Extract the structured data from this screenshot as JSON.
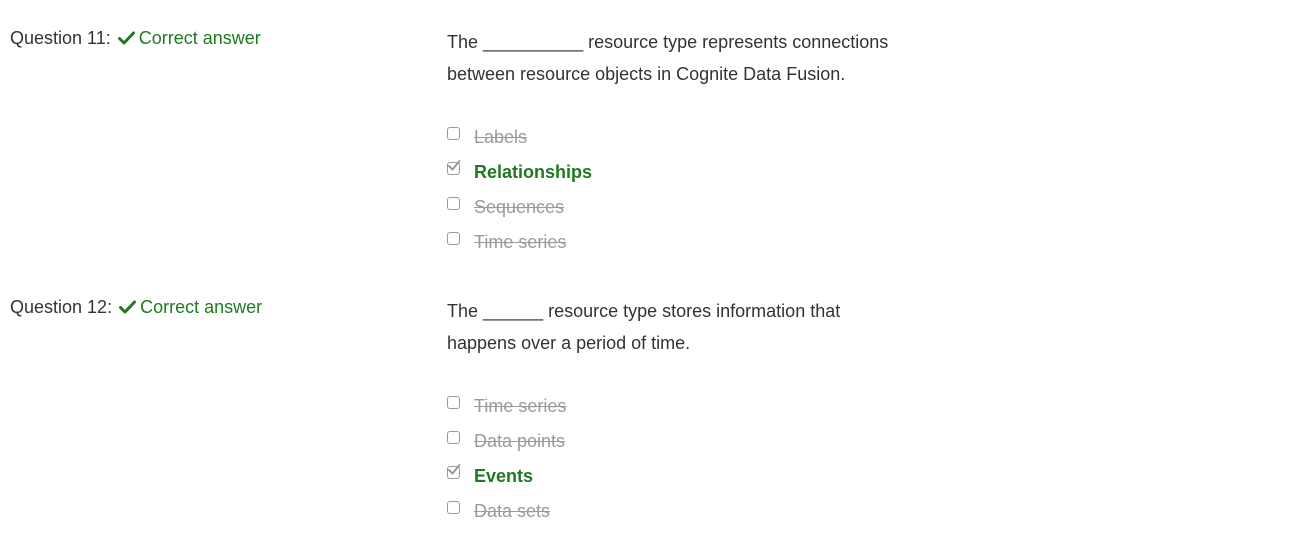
{
  "questions": [
    {
      "header": "Question 11:",
      "result": "Correct answer",
      "text_line1": "The __________ resource type represents connections",
      "text_line2": "between resource objects in Cognite Data Fusion.",
      "options": [
        {
          "label": "Labels",
          "checked": false
        },
        {
          "label": "Relationships",
          "checked": true
        },
        {
          "label": "Sequences",
          "checked": false
        },
        {
          "label": "Time series",
          "checked": false
        }
      ]
    },
    {
      "header": "Question 12:",
      "result": "Correct answer",
      "text_line1": "The ______ resource type stores information that",
      "text_line2": "happens over a period of time.",
      "options": [
        {
          "label": "Time series",
          "checked": false
        },
        {
          "label": "Data points",
          "checked": false
        },
        {
          "label": "Events",
          "checked": true
        },
        {
          "label": "Data sets",
          "checked": false
        }
      ]
    }
  ],
  "colors": {
    "correct": "#1f7a1f",
    "text": "#333333",
    "struck": "#9a9a9a"
  },
  "icons": {
    "result_icon": "check-icon",
    "selected_icon": "checked-checkbox-icon"
  }
}
